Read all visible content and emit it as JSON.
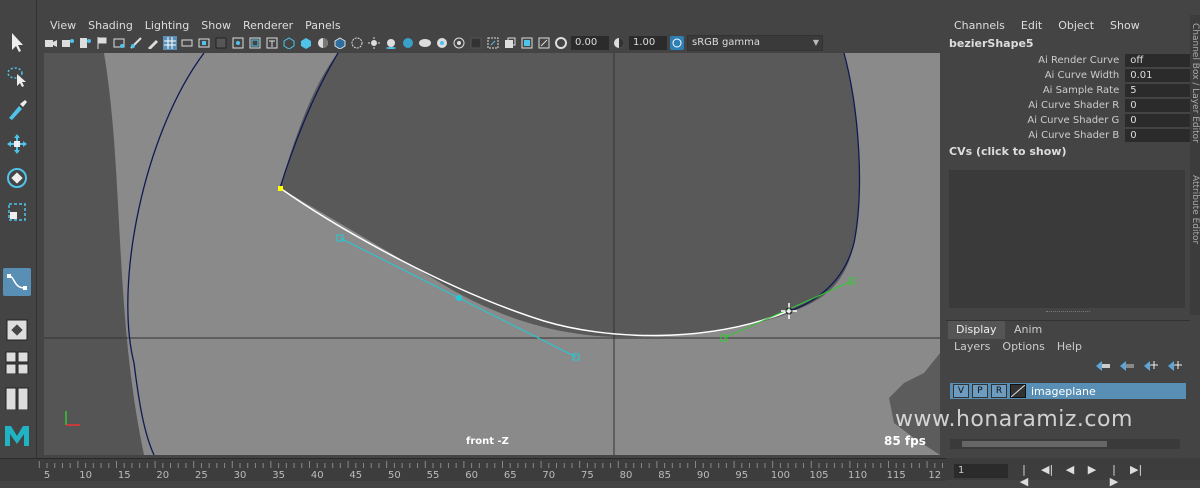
{
  "viewport": {
    "menu": [
      "View",
      "Shading",
      "Lighting",
      "Show",
      "Renderer",
      "Panels"
    ],
    "exposure": "0.00",
    "gamma": "1.00",
    "color_space": "sRGB gamma",
    "camera_label": "front -Z",
    "fps": "85 fps"
  },
  "channel_box": {
    "menu": [
      "Channels",
      "Edit",
      "Object",
      "Show"
    ],
    "shape_name": "bezierShape5",
    "attributes": [
      {
        "label": "Ai Render Curve",
        "value": "off"
      },
      {
        "label": "Ai Curve Width",
        "value": "0.01"
      },
      {
        "label": "Ai Sample Rate",
        "value": "5"
      },
      {
        "label": "Ai Curve Shader R",
        "value": "0"
      },
      {
        "label": "Ai Curve Shader G",
        "value": "0"
      },
      {
        "label": "Ai Curve Shader B",
        "value": "0"
      }
    ],
    "cvs_label": "CVs (click to show)"
  },
  "side_tabs": [
    "Channel Box / Layer Editor",
    "Attribute Editor"
  ],
  "layer_editor": {
    "tabs": [
      "Display",
      "Anim"
    ],
    "menu": [
      "Layers",
      "Options",
      "Help"
    ],
    "layer": {
      "v": "V",
      "p": "P",
      "r": "R",
      "name": "imageplane"
    }
  },
  "timeline": {
    "ticks": [
      "5",
      "10",
      "15",
      "20",
      "25",
      "30",
      "35",
      "40",
      "45",
      "50",
      "55",
      "60",
      "65",
      "70",
      "75",
      "80",
      "85",
      "90",
      "95",
      "100",
      "105",
      "110",
      "115",
      "12"
    ],
    "current_frame": "1"
  },
  "watermark": "www.honaramiz.com",
  "colors": {
    "accent": "#5a8fb5",
    "curve_selected": "#ffffff",
    "tangent_cyan": "#25c9d6",
    "tangent_green": "#35c835",
    "curve_dark": "#0f1a55"
  }
}
